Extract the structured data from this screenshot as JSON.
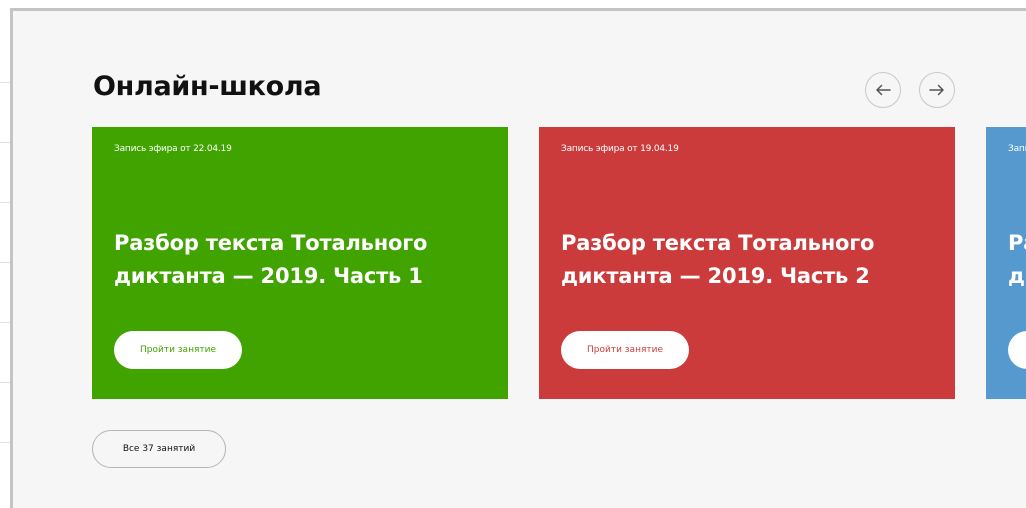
{
  "section": {
    "title": "Онлайн-школа",
    "all_button_label": "Все 37 занятий"
  },
  "navigation": {
    "prev_icon": "arrow-left-icon",
    "next_icon": "arrow-right-icon",
    "icon_color": "#555555"
  },
  "cards": [
    {
      "date_label": "Запись эфира от 22.04.19",
      "title": "Разбор текста Тотального диктанта — 2019. Часть 1",
      "button_label": "Пройти занятие",
      "color": "#41a300"
    },
    {
      "date_label": "Запись эфира от 19.04.19",
      "title": "Разбор текста Тотального диктанта — 2019. Часть 2",
      "button_label": "Пройти занятие",
      "color": "#cc3b3b"
    },
    {
      "date_label": "Запи",
      "title": "Ра д",
      "button_label": "",
      "color": "#5699cf"
    }
  ]
}
